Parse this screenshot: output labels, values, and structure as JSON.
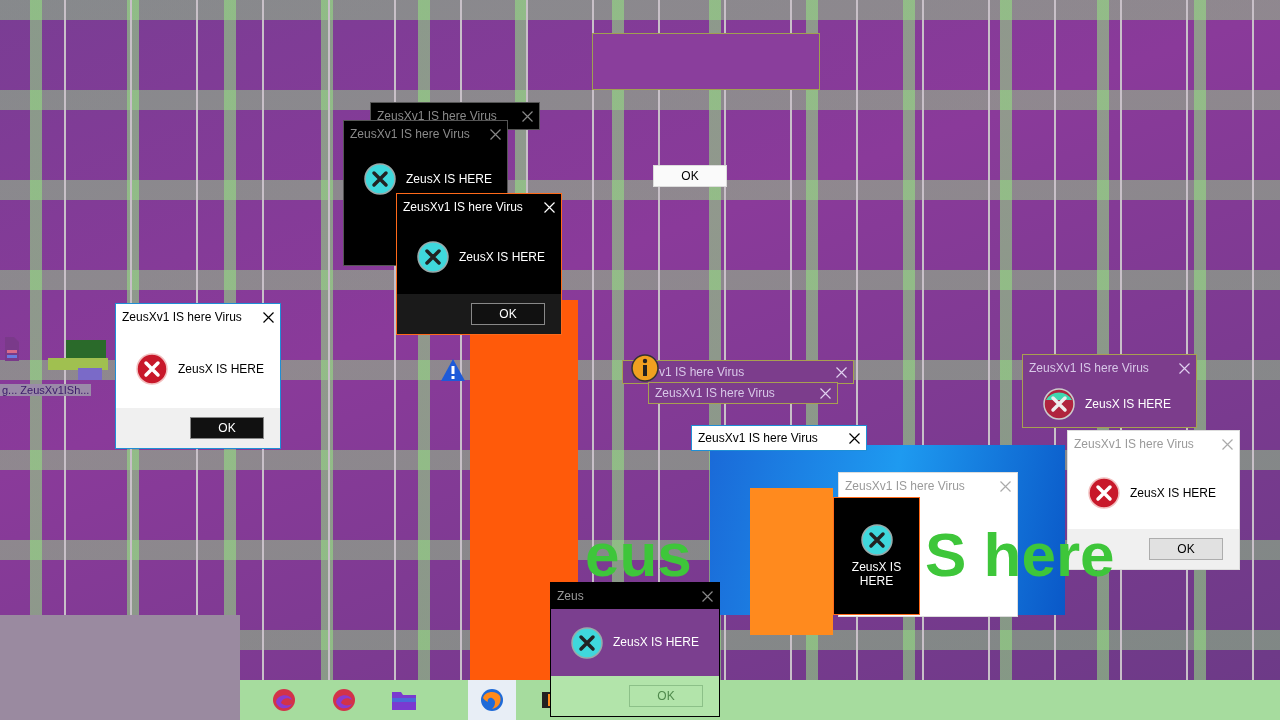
{
  "dialogs": [
    {
      "kind": "dark-faded",
      "title": "ZeusXv1 IS here Virus"
    },
    {
      "kind": "dark-faded",
      "title": "ZeusXv1 IS here Virus",
      "icon": {
        "kind": "cyan"
      },
      "message": "ZeusX IS HERE"
    },
    {
      "kind": "dark",
      "title": "ZeusXv1 IS here Virus",
      "icon": {
        "kind": "cyan"
      },
      "message": "ZeusX IS HERE",
      "button": {
        "label": "OK",
        "kind": "dark"
      }
    },
    {
      "kind": "light",
      "title": "ZeusXv1 IS here Virus",
      "icon": {
        "kind": "red"
      },
      "message": "ZeusX IS HERE",
      "button": {
        "label": "OK",
        "kind": "dark"
      }
    },
    {
      "kind": "ghost",
      "title": "v1 IS here Virus"
    },
    {
      "kind": "ghost",
      "title": "ZeusXv1 IS here Virus"
    },
    {
      "kind": "light",
      "title": "ZeusXv1 IS here Virus"
    },
    {
      "kind": "light-faded",
      "title": "ZeusXv1 IS here Virus"
    },
    {
      "kind": "dark",
      "icon": {
        "kind": "cyan"
      },
      "message": "ZeusX IS HERE"
    },
    {
      "kind": "ghost",
      "title": "ZeusXv1 IS here Virus",
      "icon": {
        "kind": "mixed"
      },
      "message": "ZeusX IS HERE"
    },
    {
      "kind": "light-faded",
      "title": "ZeusXv1 IS here Virus",
      "icon": {
        "kind": "red"
      },
      "message": "ZeusX IS HERE",
      "button": {
        "label": "OK",
        "kind": "light"
      }
    },
    {
      "kind": "glitch",
      "title": "Zeus",
      "icon": {
        "kind": "cyan"
      },
      "message": "ZeusX IS HERE",
      "button": {
        "label": "OK",
        "kind": "faint"
      }
    }
  ],
  "floating_buttons": [
    {
      "label": "OK"
    }
  ],
  "desktop_icons": [
    {
      "label": "g... ZeusXv1ISh..."
    }
  ],
  "banner_texts": [
    "eus",
    "S here"
  ],
  "taskbar": {
    "apps": [
      {
        "kind": "edge",
        "selected": false
      },
      {
        "kind": "edge",
        "selected": false
      },
      {
        "kind": "folder",
        "selected": false
      },
      {
        "kind": "firefox",
        "selected": true
      },
      {
        "kind": "app",
        "selected": false
      }
    ]
  }
}
